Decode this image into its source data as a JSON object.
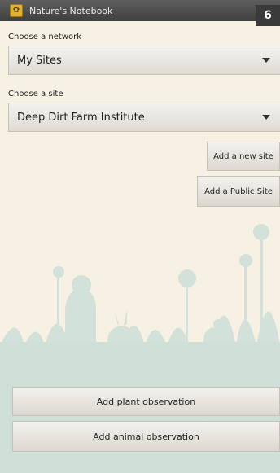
{
  "titlebar": {
    "title": "Nature's Notebook",
    "badge": "6",
    "icon": "leaf-app-icon"
  },
  "network": {
    "label": "Choose a network",
    "selected": "My Sites"
  },
  "site": {
    "label": "Choose a site",
    "selected": "Deep Dirt Farm Institute"
  },
  "actions": {
    "add_new_site": "Add a new site",
    "add_public_site": "Add a Public Site",
    "add_plant": "Add plant observation",
    "add_animal": "Add animal observation"
  },
  "colors": {
    "background": "#f6f1e3",
    "silhouette": "#cfe0d9",
    "titlebar": "#4a4a4a"
  }
}
